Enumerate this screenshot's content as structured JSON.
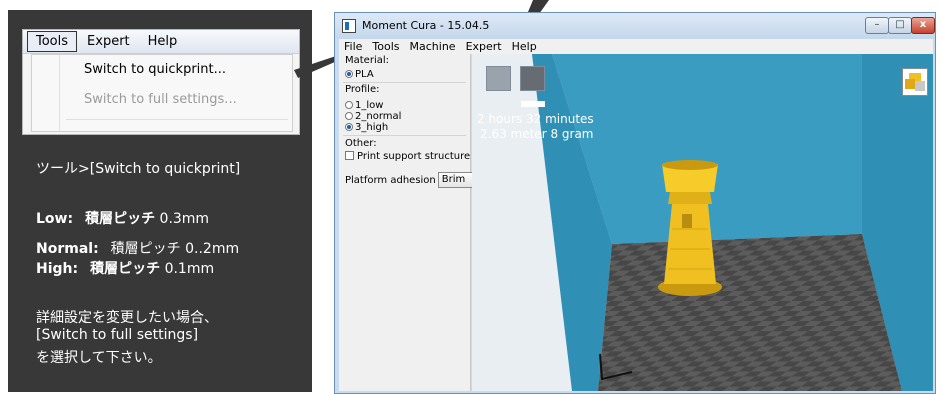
{
  "info_panel": {
    "menu_screenshot": {
      "menus": [
        "Tools",
        "Expert",
        "Help"
      ],
      "items": [
        "Switch to quickprint...",
        "Switch to full settings..."
      ]
    },
    "path_text": "ツール>[Switch to quickprint]",
    "profiles": [
      {
        "label": "Low:",
        "desc": "積層ピッチ",
        "value": "0.3mm"
      },
      {
        "label": "Normal:",
        "desc": "積層ピッチ",
        "value": "0..2mm"
      },
      {
        "label": "High:",
        "desc": "積層ピッチ",
        "value": "0.1mm"
      }
    ],
    "note_lines": [
      "詳細設定を変更したい場合、",
      "[Switch to full settings]",
      "を選択して下さい。"
    ]
  },
  "window": {
    "title": "Moment Cura - 15.04.5",
    "menus": [
      "File",
      "Tools",
      "Machine",
      "Expert",
      "Help"
    ],
    "controls": {
      "minimize": "–",
      "maximize": "□",
      "close": "x"
    }
  },
  "settings": {
    "material_label": "Material:",
    "material_option": "PLA",
    "profile_label": "Profile:",
    "profile_options": [
      "1_low",
      "2_normal",
      "3_high"
    ],
    "selected_profile": "3_high",
    "other_label": "Other:",
    "support_label": "Print support structure",
    "support_checked": false,
    "adhesion_label": "Platform adhesion",
    "adhesion_value": "Brim"
  },
  "viewport": {
    "print_time": "2 hours 32 minutes",
    "print_material": "2.63 meter 8 gram",
    "colors": {
      "wall": "#2f8fb4",
      "wall_back": "#3a9cc0",
      "floor_light": "#5c5c5c",
      "floor_dark": "#474747",
      "model": "#f0c020",
      "background": "#ffffff"
    }
  },
  "icons": [
    "load-model-icon",
    "print-icon",
    "view-mode-icon",
    "app-icon"
  ]
}
